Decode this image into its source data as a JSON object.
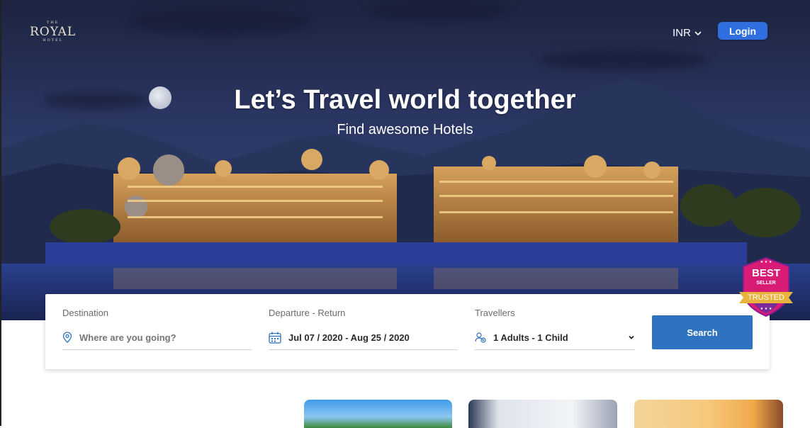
{
  "brand": {
    "logo_text": "ROYAL",
    "logo_top_text": "THE",
    "logo_bottom_text": "HOTEL"
  },
  "header": {
    "currency": "INR",
    "login_label": "Login"
  },
  "hero": {
    "title": "Let’s Travel world together",
    "subtitle": "Find awesome Hotels"
  },
  "search": {
    "destination": {
      "label": "Destination",
      "placeholder": "Where are you going?",
      "icon": "location-pin-icon"
    },
    "dates": {
      "label": "Departure - Return",
      "value": "Jul 07 / 2020 - Aug 25 / 2020",
      "icon": "calendar-icon"
    },
    "travellers": {
      "label": "Travellers",
      "value": "1 Adults - 1 Child",
      "icon": "users-icon"
    },
    "button_label": "Search"
  },
  "badge": {
    "line1": "BEST",
    "line2": "SELLER",
    "line3": "TRUSTED"
  },
  "colors": {
    "accent": "#2f6fe0",
    "search_button": "#2f72c0",
    "badge_pink": "#d81b74",
    "badge_gold": "#e8b33c"
  }
}
